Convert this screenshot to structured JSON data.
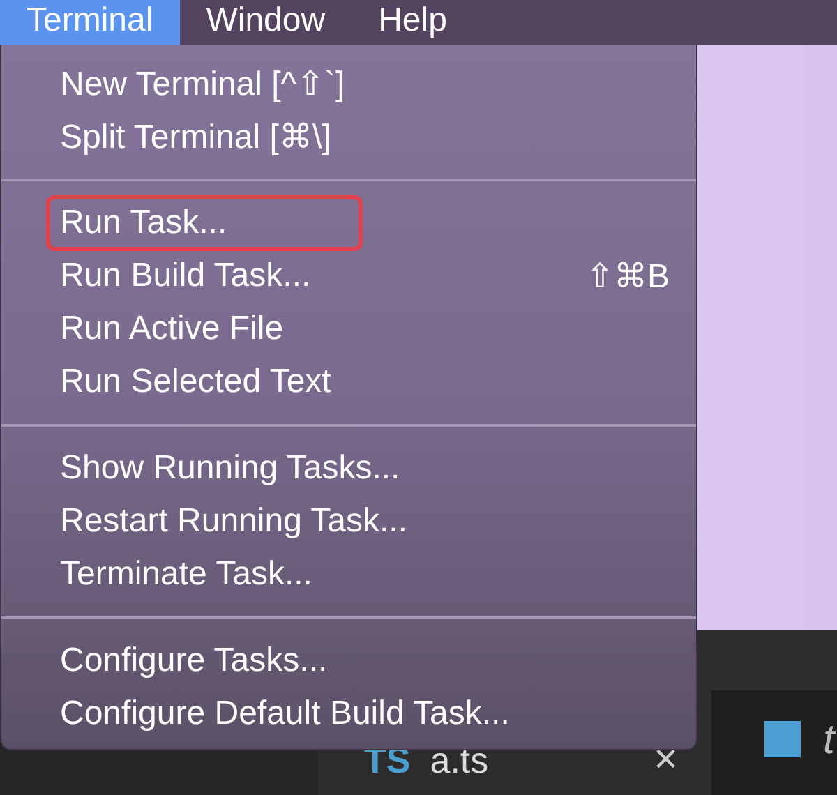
{
  "menu_bar": [
    {
      "label": "Terminal",
      "selected": true
    },
    {
      "label": "Window",
      "selected": false
    },
    {
      "label": "Help",
      "selected": false
    }
  ],
  "menu": {
    "groups": [
      {
        "items": [
          {
            "label": "New Terminal [^⇧`]",
            "outlined": false
          },
          {
            "label": "Split Terminal [⌘\\]",
            "outlined": false
          }
        ]
      },
      {
        "items": [
          {
            "label": "Run Task...",
            "outlined": true
          },
          {
            "label": "Run Build Task...",
            "shortcut": "⇧⌘B",
            "outlined": false
          },
          {
            "label": "Run Active File",
            "outlined": false
          },
          {
            "label": "Run Selected Text",
            "outlined": false
          }
        ]
      },
      {
        "items": [
          {
            "label": "Show Running Tasks...",
            "outlined": false
          },
          {
            "label": "Restart Running Task...",
            "outlined": false
          },
          {
            "label": "Terminate Task...",
            "outlined": false
          }
        ]
      },
      {
        "items": [
          {
            "label": "Configure Tasks...",
            "outlined": false
          },
          {
            "label": "Configure Default Build Task...",
            "outlined": false
          }
        ]
      }
    ]
  },
  "editor_tabs": [
    {
      "icon": "TS",
      "label": "a.ts",
      "close": "×"
    },
    {
      "label": "t"
    }
  ]
}
